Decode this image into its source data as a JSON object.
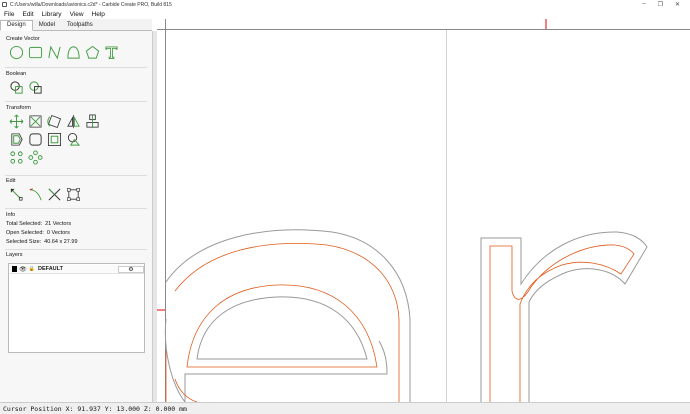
{
  "window": {
    "title": "C:/Users/willa/Downloads/avionics.c2d* - Carbide Create PRO, Build 815",
    "controls": [
      "–",
      "❐",
      "✕"
    ]
  },
  "menu": [
    "File",
    "Edit",
    "Library",
    "View",
    "Help"
  ],
  "tabs": {
    "items": [
      "Design",
      "Model",
      "Toolpaths"
    ],
    "active": "Design"
  },
  "sections": {
    "create_vector": {
      "title": "Create Vector",
      "tools": [
        "circle-tool-icon",
        "rectangle-tool-icon",
        "polyline-tool-icon",
        "curve-tool-icon",
        "polygon-tool-icon",
        "text-tool-icon"
      ]
    },
    "boolean": {
      "title": "Boolean",
      "tools": [
        "union-icon",
        "subtract-icon"
      ]
    },
    "transform": {
      "title": "Transform",
      "rows": [
        [
          "move-icon",
          "scale-icon",
          "rotate-icon",
          "mirror-icon",
          "align-icon"
        ],
        [
          "offset-icon",
          "fillet-icon",
          "inset-icon",
          "outline-icon"
        ],
        [
          "array-icon",
          "circular-array-icon"
        ]
      ]
    },
    "edit": {
      "title": "Edit",
      "tools": [
        "node-edit-icon",
        "bezier-icon",
        "trim-icon",
        "bounding-box-icon"
      ]
    },
    "info": {
      "title": "Info",
      "total_selected_label": "Total Selected:",
      "total_selected_value": "21 Vectors",
      "open_selected_label": "Open Selected:",
      "open_selected_value": "0 Vectors",
      "selected_size_label": "Selected Size:",
      "selected_size_value": "40.64 x 27.99"
    },
    "layers": {
      "title": "Layers",
      "items": [
        {
          "name": "DEFAULT",
          "color": "#000000"
        }
      ]
    }
  },
  "colors": {
    "icon_green": "#3f9b3f",
    "vector_gray": "#9a9a9a",
    "toolpath_orange": "#e05a1a",
    "ruler_red": "#e03030"
  },
  "status": {
    "text": "Cursor Position X: 91.937 Y: 13.000 Z: 0.000 mm"
  }
}
